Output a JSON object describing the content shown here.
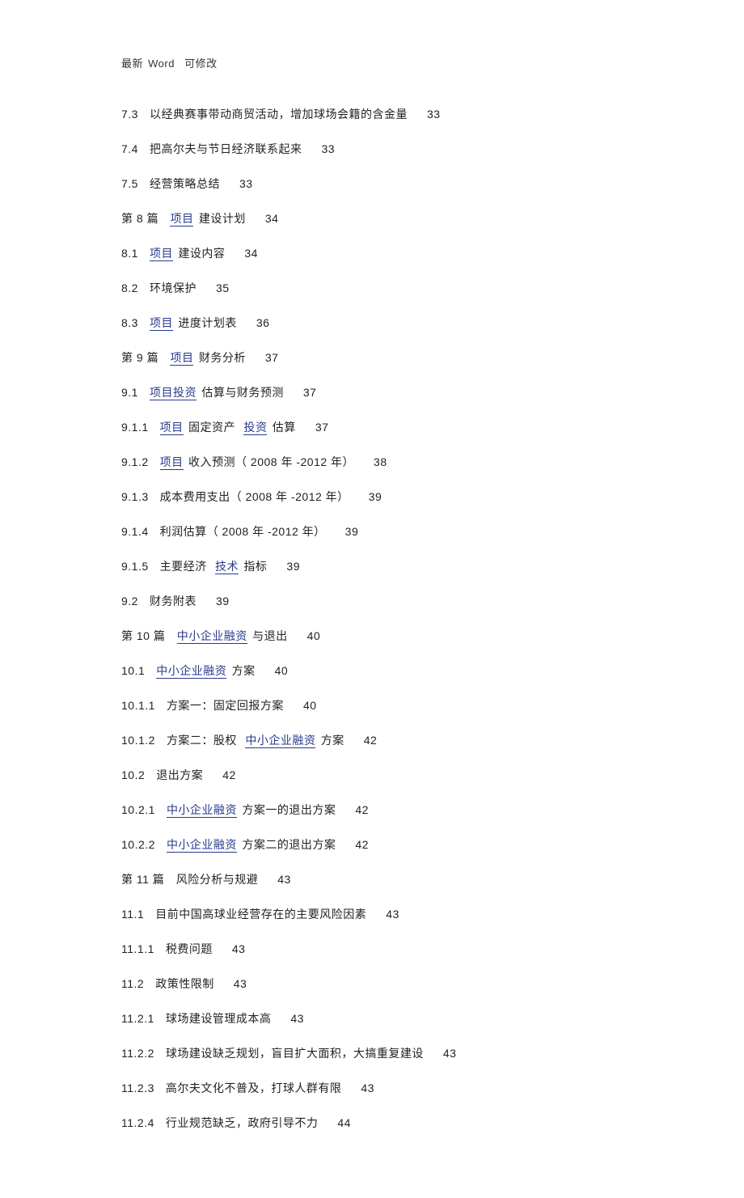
{
  "header": {
    "p1": "最新",
    "p2": "Word",
    "p3": "可修改"
  },
  "lines": [
    {
      "num": "7.3",
      "parts": [
        {
          "t": "以经典赛事带动商贸活动，增加球场会籍的含金量"
        }
      ],
      "page": "33"
    },
    {
      "num": "7.4",
      "parts": [
        {
          "t": "把高尔夫与节日经济联系起来"
        }
      ],
      "page": "33"
    },
    {
      "num": "7.5",
      "parts": [
        {
          "t": "经营策略总结"
        }
      ],
      "page": "33"
    },
    {
      "chapter": true,
      "num": "第 8 篇",
      "parts": [
        {
          "t": "项目",
          "link": true
        },
        {
          "t": " 建设计划"
        }
      ],
      "page": "34"
    },
    {
      "num": "8.1",
      "parts": [
        {
          "t": "项目",
          "link": true
        },
        {
          "t": " 建设内容"
        }
      ],
      "page": "34"
    },
    {
      "num": "8.2",
      "parts": [
        {
          "t": "环境保护"
        }
      ],
      "page": "35"
    },
    {
      "num": "8.3",
      "parts": [
        {
          "t": "项目",
          "link": true
        },
        {
          "t": " 进度计划表"
        }
      ],
      "page": "36"
    },
    {
      "chapter": true,
      "num": "第 9 篇",
      "parts": [
        {
          "t": "项目",
          "link": true
        },
        {
          "t": " 财务分析"
        }
      ],
      "page": "37"
    },
    {
      "num": "9.1",
      "parts": [
        {
          "t": "项目投资",
          "link": true
        },
        {
          "t": " 估算与财务预测"
        }
      ],
      "page": "37"
    },
    {
      "num": "9.1.1",
      "parts": [
        {
          "t": "项目",
          "link": true
        },
        {
          "t": " 固定资产 "
        },
        {
          "t": "投资",
          "link": true
        },
        {
          "t": " 估算"
        }
      ],
      "page": "37"
    },
    {
      "num": "9.1.2",
      "parts": [
        {
          "t": "项目",
          "link": true
        },
        {
          "t": " 收入预测（ 2008 年 -2012 年）"
        }
      ],
      "page": "38"
    },
    {
      "num": "9.1.3",
      "parts": [
        {
          "t": "成本费用支出（ 2008 年 -2012 年）"
        }
      ],
      "page": "39"
    },
    {
      "num": "9.1.4",
      "parts": [
        {
          "t": "利润估算（ 2008 年 -2012 年）"
        }
      ],
      "page": "39"
    },
    {
      "num": "9.1.5",
      "parts": [
        {
          "t": "主要经济 "
        },
        {
          "t": "技术",
          "link": true
        },
        {
          "t": " 指标"
        }
      ],
      "page": "39"
    },
    {
      "num": "9.2",
      "parts": [
        {
          "t": "财务附表"
        }
      ],
      "page": "39"
    },
    {
      "chapter": true,
      "num": "第 10 篇",
      "parts": [
        {
          "t": "中小企业融资",
          "link": true
        },
        {
          "t": " 与退出"
        }
      ],
      "page": "40"
    },
    {
      "num": "10.1",
      "parts": [
        {
          "t": "中小企业融资",
          "link": true
        },
        {
          "t": " 方案"
        }
      ],
      "page": "40"
    },
    {
      "num": "10.1.1",
      "parts": [
        {
          "t": "方案一：固定回报方案"
        }
      ],
      "page": "40"
    },
    {
      "num": "10.1.2",
      "parts": [
        {
          "t": "方案二：股权 "
        },
        {
          "t": "中小企业融资",
          "link": true
        },
        {
          "t": " 方案"
        }
      ],
      "page": "42"
    },
    {
      "num": "10.2",
      "parts": [
        {
          "t": "退出方案"
        }
      ],
      "page": "42"
    },
    {
      "num": "10.2.1",
      "parts": [
        {
          "t": "中小企业融资",
          "link": true
        },
        {
          "t": " 方案一的退出方案"
        }
      ],
      "page": "42"
    },
    {
      "num": "10.2.2",
      "parts": [
        {
          "t": "中小企业融资",
          "link": true
        },
        {
          "t": " 方案二的退出方案"
        }
      ],
      "page": "42"
    },
    {
      "chapter": true,
      "num": "第 11 篇",
      "parts": [
        {
          "t": "风险分析与规避"
        }
      ],
      "page": "43"
    },
    {
      "num": "11.1",
      "parts": [
        {
          "t": "目前中国高球业经营存在的主要风险因素"
        }
      ],
      "page": "43"
    },
    {
      "num": "11.1.1",
      "parts": [
        {
          "t": "税费问题"
        }
      ],
      "page": "43"
    },
    {
      "num": "11.2",
      "parts": [
        {
          "t": "政策性限制"
        }
      ],
      "page": "43"
    },
    {
      "num": "11.2.1",
      "parts": [
        {
          "t": "球场建设管理成本高"
        }
      ],
      "page": "43"
    },
    {
      "num": "11.2.2",
      "parts": [
        {
          "t": "球场建设缺乏规划，盲目扩大面积，大搞重复建设"
        }
      ],
      "page": "43"
    },
    {
      "num": "11.2.3",
      "parts": [
        {
          "t": "高尔夫文化不普及，打球人群有限"
        }
      ],
      "page": "43"
    },
    {
      "num": "11.2.4",
      "parts": [
        {
          "t": "行业规范缺乏，政府引导不力"
        }
      ],
      "page": "44"
    }
  ]
}
